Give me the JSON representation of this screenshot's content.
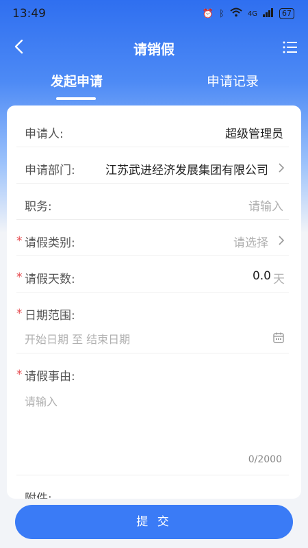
{
  "status_bar": {
    "time": "13:49",
    "icons": [
      "alarm-icon",
      "bluetooth-icon",
      "wifi-icon",
      "signal-icon"
    ],
    "network": "4G",
    "battery": "67"
  },
  "nav": {
    "title": "请销假",
    "back_icon": "chevron-left-icon",
    "menu_icon": "list-icon"
  },
  "tabs": [
    {
      "label": "发起申请",
      "active": true
    },
    {
      "label": "申请记录",
      "active": false
    }
  ],
  "form": {
    "required_mark": "*",
    "applicant": {
      "label": "申请人:",
      "value": "超级管理员"
    },
    "department": {
      "label": "申请部门:",
      "value": "江苏武进经济发展集团有限公司"
    },
    "position": {
      "label": "职务:",
      "placeholder": "请输入"
    },
    "leave_type": {
      "label": "请假类别:",
      "placeholder": "请选择"
    },
    "leave_days": {
      "label": "请假天数:",
      "value": "0.0",
      "unit": "天"
    },
    "date_range": {
      "label": "日期范围:",
      "placeholder": "开始日期 至 结束日期"
    },
    "reason": {
      "label": "请假事由:",
      "placeholder": "请输入",
      "counter": "0/2000"
    },
    "attachment": {
      "label": "附件:"
    }
  },
  "submit_label": "提 交",
  "colors": {
    "accent": "#3a7bf6",
    "required": "#e5484d"
  }
}
